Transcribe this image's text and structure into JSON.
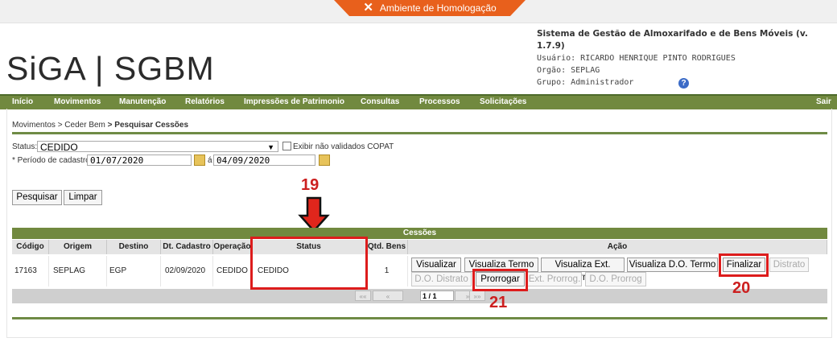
{
  "env": {
    "label": "Ambiente de Homologação"
  },
  "header": {
    "logo": "SiGA | SGBM",
    "system_title": "Sistema de Gestão de Almoxarifado e de Bens Móveis (v. 1.7.9)",
    "user": "Usuário: RICARDO HENRIQUE PINTO RODRIGUES",
    "org": "Orgão: SEPLAG",
    "group": "Grupo: Administrador"
  },
  "nav": {
    "items": [
      "Início",
      "Movimentos",
      "Manutenção",
      "Relatórios",
      "Impressões de Patrimonio",
      "Consultas",
      "Processos",
      "Solicitações"
    ],
    "logout": "Sair"
  },
  "breadcrumb": {
    "a": "Movimentos",
    "b": "> Ceder Bem",
    "c": "> Pesquisar Cessões"
  },
  "filters": {
    "status_label": "Status:",
    "status_value": "CEDIDO",
    "checkbox_label": "Exibir não validados COPAT",
    "period_label": "* Período de cadastro:",
    "date_from": "01/07/2020",
    "date_sep": "á",
    "date_to": "04/09/2020",
    "search_btn": "Pesquisar",
    "clear_btn": "Limpar"
  },
  "table": {
    "title": "Cessões",
    "columns": [
      "Código",
      "Origem",
      "Destino",
      "Dt. Cadastro",
      "Operação",
      "Status",
      "Qtd. Bens",
      "Ação"
    ],
    "row": {
      "codigo": "17163",
      "origem": "SEPLAG",
      "destino": "EGP",
      "dt": "02/09/2020",
      "operacao": "CEDIDO",
      "status": "CEDIDO",
      "qtd": "1"
    },
    "actions": {
      "visualizar": "Visualizar",
      "visualiza_termo": "Visualiza Termo",
      "visualiza_ext": "Visualiza Ext. Termo",
      "visualiza_do": "Visualiza D.O. Termo",
      "finalizar": "Finalizar",
      "distrato": "Distrato",
      "do_distrato": "D.O. Distrato",
      "prorrogar": "Prorrogar",
      "ext_prorrog": "Ext. Prorrog.",
      "do_prorrog": "D.O. Prorrog"
    },
    "pager": {
      "first": "««",
      "prev": "«",
      "page": "1 / 1",
      "next": "»",
      "last": "»»"
    }
  },
  "annotations": {
    "n19": "19",
    "n20": "20",
    "n21": "21"
  },
  "colors": {
    "accent_green": "#71893f",
    "env_orange": "#e8601c",
    "highlight_red": "#dd1c1c"
  }
}
